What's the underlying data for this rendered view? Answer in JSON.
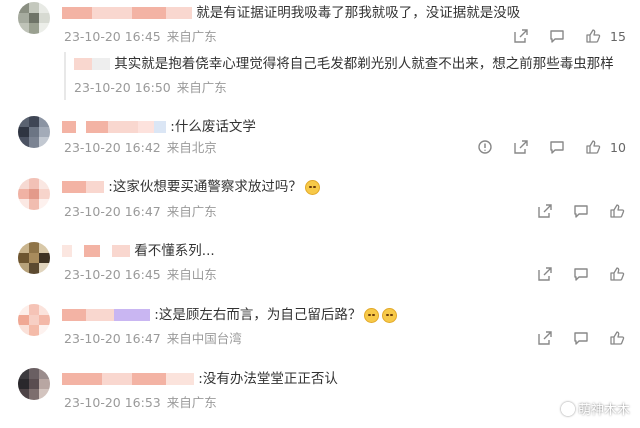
{
  "comments": [
    {
      "text": "就是有证据证明我吸毒了那我就吸了，没证据就是没吸",
      "date": "23-10-20 16:45",
      "location": "来自广东",
      "like_count": "15",
      "has_report": false,
      "reply": {
        "text": "其实就是抱着侥幸心理觉得将自己毛发都剃光别人就查不出来，想之前那些毒虫那样",
        "date": "23-10-20 16:50",
        "location": "来自广东"
      }
    },
    {
      "text": ":什么废话文学",
      "date": "23-10-20 16:42",
      "location": "来自北京",
      "like_count": "10",
      "has_report": true
    },
    {
      "text": ":这家伙想要买通警察求放过吗？",
      "date": "23-10-20 16:47",
      "location": "来自广东",
      "like_count": "",
      "has_report": false
    },
    {
      "text": "看不懂系列...",
      "date": "23-10-20 16:45",
      "location": "来自山东",
      "like_count": "",
      "has_report": false
    },
    {
      "text": ":这是顾左右而言，为自己留后路？",
      "date": "23-10-20 16:47",
      "location": "来自中国台湾",
      "like_count": "",
      "has_report": false
    },
    {
      "text": ":没有办法堂堂正正否认",
      "date": "23-10-20 16:53",
      "location": "来自广东",
      "like_count": "",
      "has_report": false
    }
  ],
  "watermark": "萌神木木",
  "icons": {
    "share": "share-icon",
    "comment": "comment-icon",
    "like": "thumbs-up-icon",
    "report": "report-icon",
    "emoji": "emoji-icon",
    "watermark_logo": "logo-icon"
  },
  "colors": {
    "blur_pink": "#f3b3a4",
    "blur_light": "#f9d7cf",
    "blur_lilac": "#c9b6f2",
    "meta_gray": "#9a9a9a"
  }
}
